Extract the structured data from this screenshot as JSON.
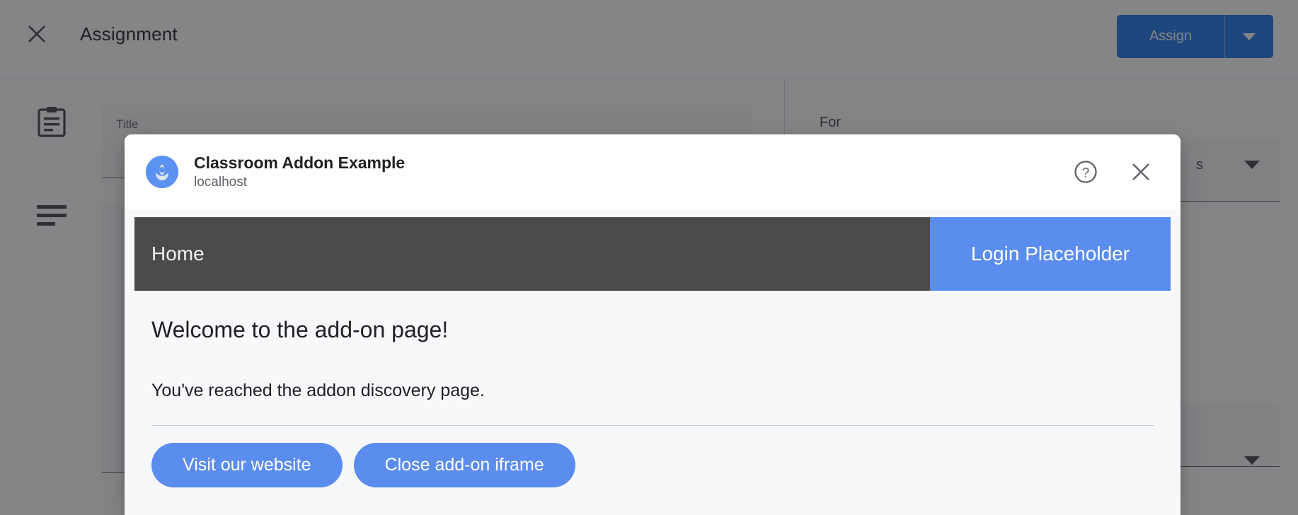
{
  "background": {
    "close_icon": "close-icon",
    "page_title": "Assignment",
    "assign_button": "Assign",
    "assign_dropdown_icon": "chevron-down-icon",
    "assignment_icon": "clipboard-icon",
    "description_icon": "description-lines-icon",
    "title_field_label": "Title",
    "for_label": "For",
    "for_value": "s",
    "for_caret_icon": "chevron-down-icon",
    "second_select_caret_icon": "chevron-down-icon"
  },
  "dialog": {
    "app_icon": "addon-app-icon",
    "app_name": "Classroom Addon Example",
    "origin": "localhost",
    "help_icon": "help-circle-icon",
    "close_icon": "close-icon",
    "iframe": {
      "navbar": {
        "home_label": "Home",
        "login_label": "Login Placeholder"
      },
      "heading": "Welcome to the add-on page!",
      "paragraph": "You've reached the addon discovery page.",
      "buttons": [
        {
          "label": "Visit our website"
        },
        {
          "label": "Close add-on iframe"
        }
      ]
    }
  },
  "colors": {
    "navbar_dark": "#4a4a4a",
    "accent_blue": "#5b8def",
    "iframe_bg": "#f6f8fa",
    "classroom_blue": "#1a73e8",
    "scrim": "rgba(32,33,36,0.55)"
  }
}
